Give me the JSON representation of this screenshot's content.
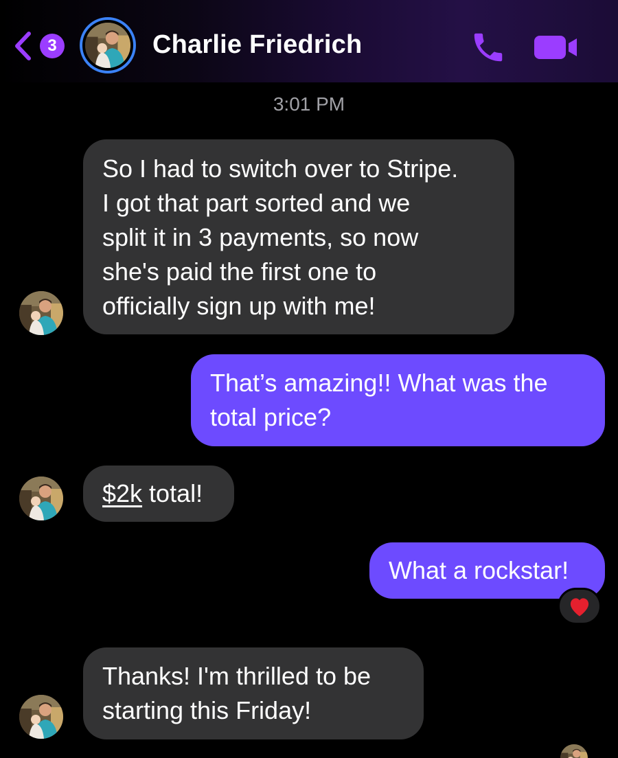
{
  "header": {
    "unread_count": "3",
    "contact_name": "Charlie Friedrich",
    "icons": {
      "back": "chevron-left-icon",
      "call": "phone-icon",
      "video": "video-camera-icon"
    },
    "accent_color": "#9b3dff"
  },
  "timestamp": "3:01 PM",
  "messages": [
    {
      "direction": "incoming",
      "lines": [
        "So I had to switch over to Stripe.",
        "I got that part sorted and we",
        "split it in 3 payments, so now",
        "she's paid the first one to",
        "officially sign up with me!"
      ]
    },
    {
      "direction": "outgoing",
      "lines": [
        "That’s amazing!! What was the",
        "total price?"
      ]
    },
    {
      "direction": "incoming",
      "money": "$2k",
      "rest": " total!"
    },
    {
      "direction": "outgoing",
      "lines": [
        "What a rockstar!"
      ],
      "reaction": "❤️"
    },
    {
      "direction": "incoming",
      "lines": [
        "Thanks! I'm thrilled to be",
        "starting this Friday!"
      ]
    }
  ],
  "colors": {
    "incoming_bubble": "#333334",
    "outgoing_bubble": "#6d4bff",
    "background": "#000000"
  }
}
